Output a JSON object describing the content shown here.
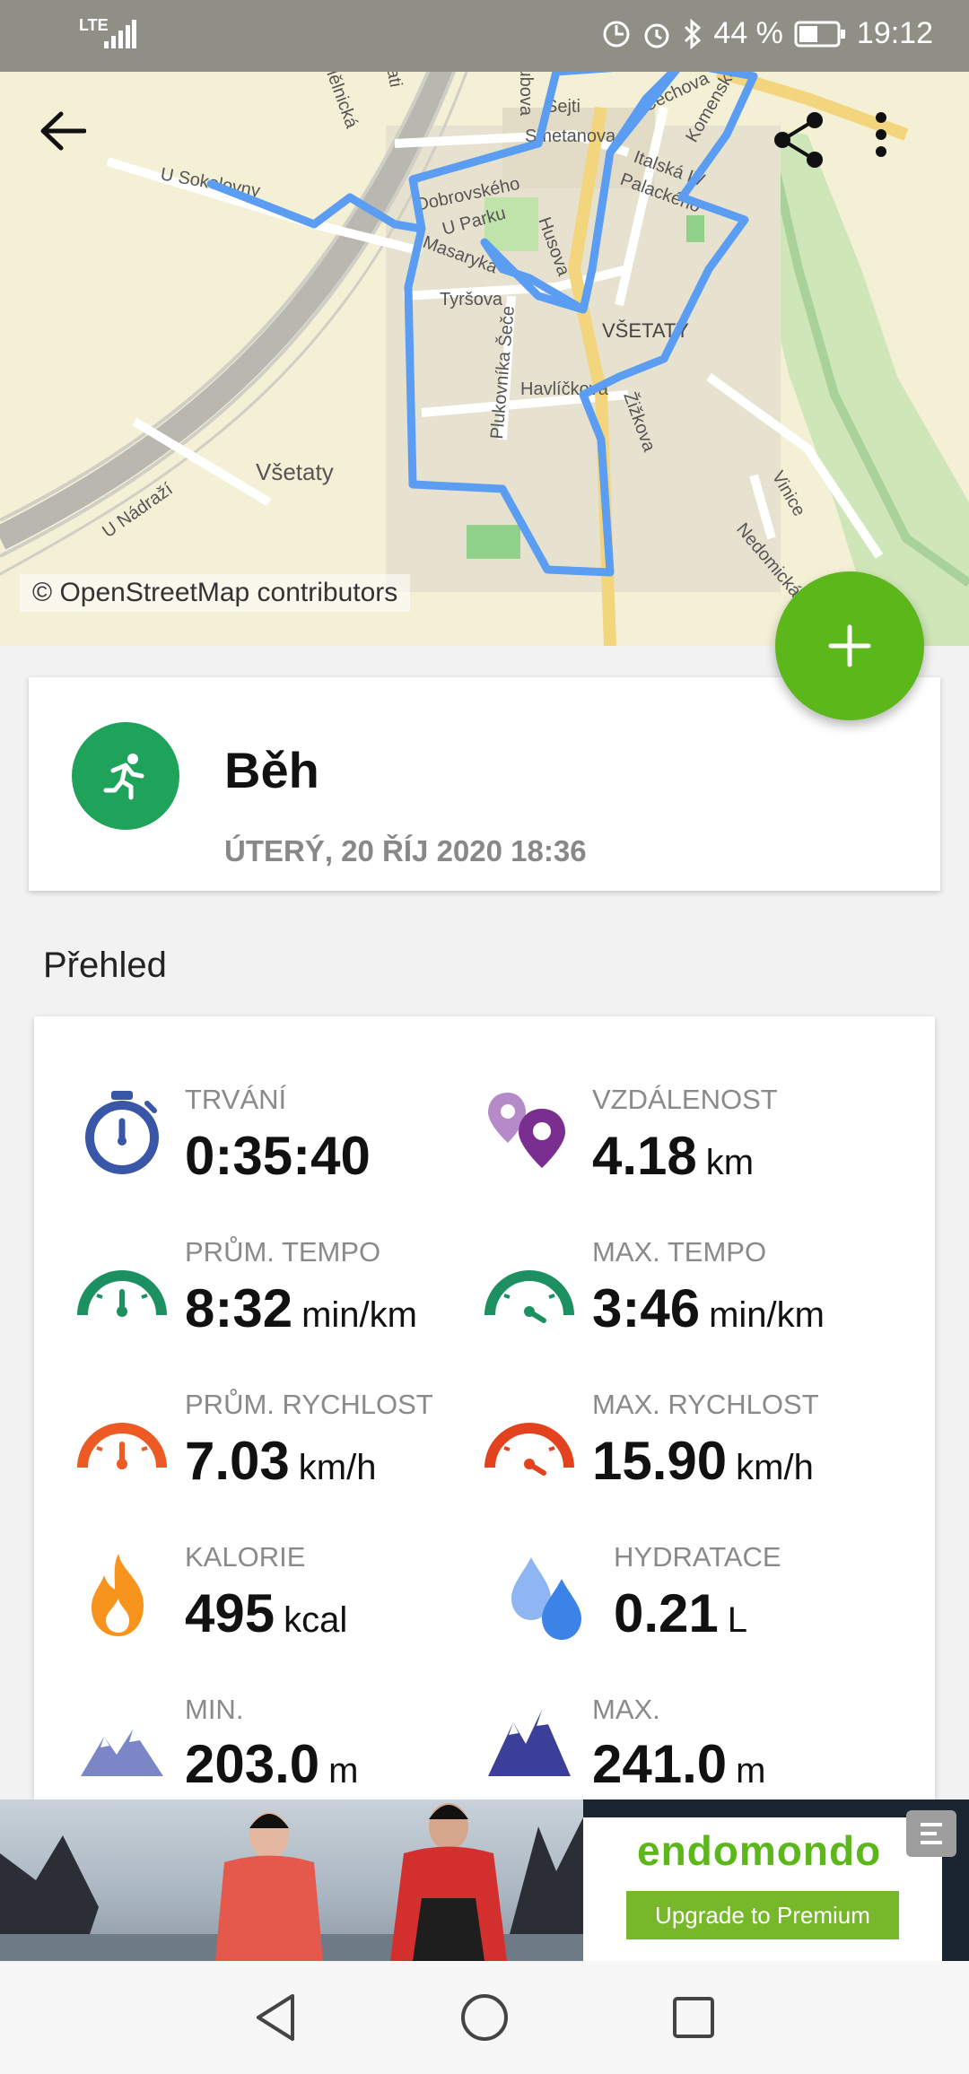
{
  "status_bar": {
    "network": "LTE",
    "battery": "44 %",
    "time": "19:12"
  },
  "map": {
    "attribution": "© OpenStreetMap contributors",
    "labels": [
      "Mělnická",
      "U Trati",
      "Hubova",
      "Sejti",
      "Smetanova",
      "Dobrovského",
      "U Parku",
      "Masaryka",
      "Tyršova",
      "Husova",
      "Plukovníka Šeče",
      "Havlíčkova",
      "VŠETATY",
      "Žižkova",
      "Všetaty",
      "U Nádraží",
      "Nedomická",
      "Vinice",
      "Komenského",
      "Čechova",
      "Palackého",
      "Italská IV",
      "U Sokolovny"
    ],
    "route_color": "#5b9df2"
  },
  "toolbar": {
    "back_icon": "arrow-left-icon",
    "share_icon": "share-icon",
    "menu_icon": "more-vert-icon"
  },
  "fab": {
    "icon": "plus-icon",
    "color": "#5cb71b"
  },
  "activity": {
    "title": "Běh",
    "date": "ÚTERÝ, 20 ŘÍJ 2020 18:36",
    "icon": "running-icon",
    "icon_color": "#1fa35b"
  },
  "overview": {
    "heading": "Přehled",
    "stats": [
      {
        "label": "TRVÁNÍ",
        "value": "0:35:40",
        "unit": "",
        "icon": "stopwatch-icon"
      },
      {
        "label": "VZDÁLENOST",
        "value": "4.18",
        "unit": "km",
        "icon": "location-pins-icon"
      },
      {
        "label": "PRŮM. TEMPO",
        "value": "8:32",
        "unit": "min/km",
        "icon": "gauge-green-icon"
      },
      {
        "label": "MAX. TEMPO",
        "value": "3:46",
        "unit": "min/km",
        "icon": "gauge-green-max-icon"
      },
      {
        "label": "PRŮM. RYCHLOST",
        "value": "7.03",
        "unit": "km/h",
        "icon": "gauge-orange-icon"
      },
      {
        "label": "MAX. RYCHLOST",
        "value": "15.90",
        "unit": "km/h",
        "icon": "gauge-red-icon"
      },
      {
        "label": "KALORIE",
        "value": "495",
        "unit": "kcal",
        "icon": "flame-icon"
      },
      {
        "label": "HYDRATACE",
        "value": "0.21",
        "unit": "L",
        "icon": "water-drops-icon"
      },
      {
        "label": "MIN.",
        "value": "203.0",
        "unit": "m",
        "icon": "mountain-light-icon"
      },
      {
        "label": "MAX.",
        "value": "241.0",
        "unit": "m",
        "icon": "mountain-dark-icon"
      }
    ]
  },
  "ad": {
    "brand": "endomondo",
    "button": "Upgrade to Premium"
  },
  "nav": {
    "back": "nav-back-icon",
    "home": "nav-home-icon",
    "recents": "nav-recents-icon"
  }
}
